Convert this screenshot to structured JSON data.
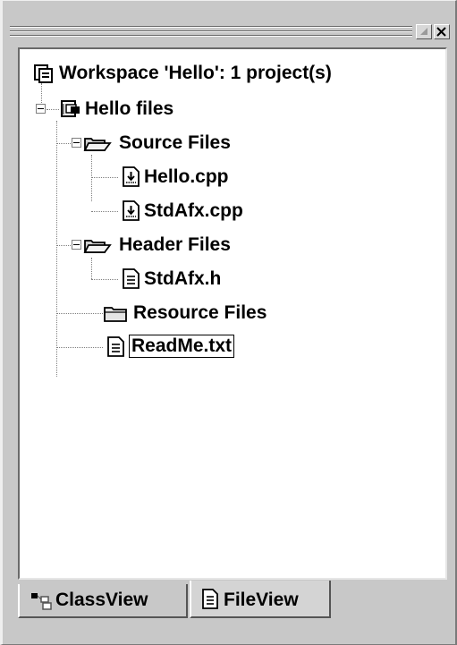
{
  "window": {
    "minimize_icon": "minimize-icon",
    "close_icon": "close-icon"
  },
  "tree": {
    "workspace": {
      "label": "Workspace 'Hello': 1 project(s)",
      "icon": "workspace-icon"
    },
    "project": {
      "label": "Hello files",
      "icon": "project-icon"
    },
    "source_folder": {
      "label": "Source Files",
      "icon": "folder-open-icon"
    },
    "source_files": [
      {
        "label": "Hello.cpp",
        "icon": "cpp-file-icon"
      },
      {
        "label": "StdAfx.cpp",
        "icon": "cpp-file-icon"
      }
    ],
    "header_folder": {
      "label": "Header Files",
      "icon": "folder-open-icon"
    },
    "header_files": [
      {
        "label": "StdAfx.h",
        "icon": "text-file-icon"
      }
    ],
    "resource_folder": {
      "label": "Resource Files",
      "icon": "folder-closed-icon"
    },
    "readme": {
      "label": "ReadMe.txt",
      "icon": "text-file-icon"
    }
  },
  "tabs": [
    {
      "label": "ClassView",
      "icon": "classview-icon",
      "active": false
    },
    {
      "label": "FileView",
      "icon": "fileview-icon",
      "active": true
    }
  ],
  "colors": {
    "panel": "#c8c8c8",
    "tree_bg": "#ffffff",
    "text": "#000000"
  }
}
